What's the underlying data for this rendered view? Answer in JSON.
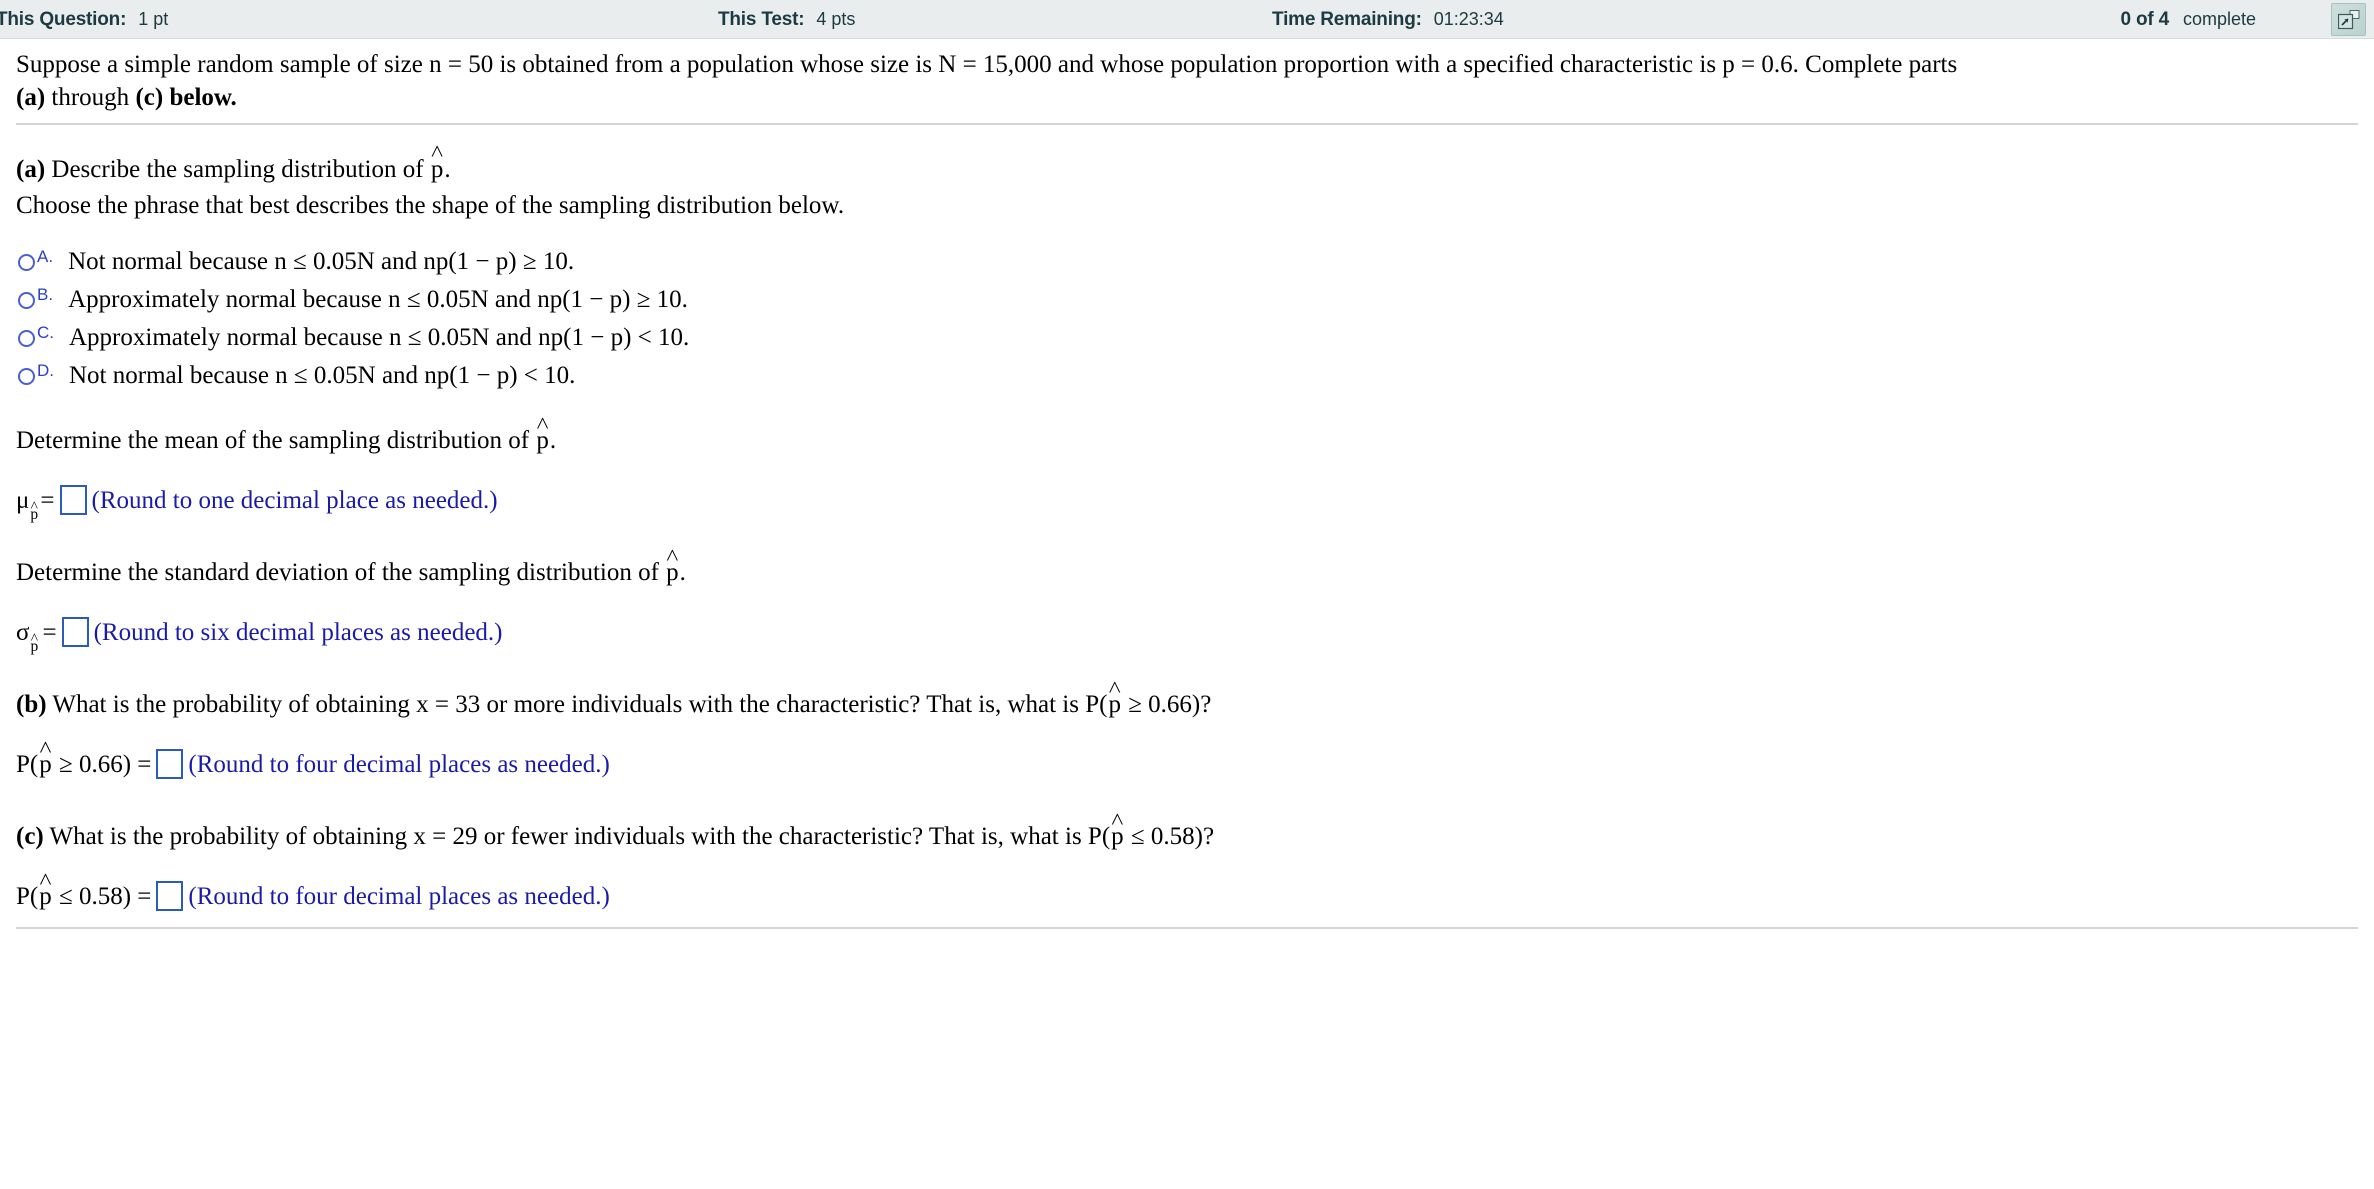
{
  "header": {
    "this_question_label": "This Question:",
    "this_question_value": "1 pt",
    "this_test_label": "This Test:",
    "this_test_value": "4 pts",
    "time_label": "Time Remaining:",
    "time_value": "01:23:34",
    "progress_count": "0 of 4",
    "progress_word": "complete",
    "expand_icon": "popout-window-icon"
  },
  "problem": {
    "intro_line1": "Suppose a simple random sample of size n = 50 is obtained from a population whose size is N = 15,000 and whose population proportion with a specified characteristic is p = 0.6. Complete parts",
    "intro_line2_bold_a": "(a)",
    "intro_line2_mid": " through ",
    "intro_line2_bold_c": "(c)",
    "intro_line2_end": " below."
  },
  "part_a": {
    "label": "(a)",
    "prompt_pre": " Describe the sampling distribution of ",
    "prompt_post": ".",
    "instruction": "Choose the phrase that best describes the shape of the sampling distribution below.",
    "choices": [
      {
        "letter": "A.",
        "text": "Not normal because n ≤ 0.05N and np(1 − p) ≥ 10.",
        "selected": false
      },
      {
        "letter": "B.",
        "text": "Approximately normal because n ≤ 0.05N and np(1 − p) ≥ 10.",
        "selected": false
      },
      {
        "letter": "C.",
        "text": "Approximately normal because n ≤ 0.05N and np(1 − p) < 10.",
        "selected": false
      },
      {
        "letter": "D.",
        "text": "Not normal because n ≤ 0.05N and np(1 − p) < 10.",
        "selected": false
      }
    ],
    "mean_prompt_pre": "Determine the mean of the sampling distribution of ",
    "mean_prompt_post": ".",
    "mean_symbol": "μ",
    "mean_equals": "=",
    "mean_value": "",
    "mean_hint": "(Round to one decimal place as needed.)",
    "sd_prompt_pre": "Determine the standard deviation of the sampling distribution of ",
    "sd_prompt_post": ".",
    "sd_symbol": "σ",
    "sd_equals": "=",
    "sd_value": "",
    "sd_hint": "(Round to six decimal places as needed.)"
  },
  "part_b": {
    "label": "(b)",
    "question_pre": " What is the probability of obtaining x = 33 or more individuals with the characteristic? That is, what is P(",
    "question_post": " ≥ 0.66)?",
    "answer_pre": "P(",
    "answer_post": " ≥ 0.66) =",
    "answer_value": "",
    "hint": "(Round to four decimal places as needed.)"
  },
  "part_c": {
    "label": "(c)",
    "question_pre": " What is the probability of obtaining x = 29 or fewer individuals with the characteristic? That is, what is P(",
    "question_post": " ≤ 0.58)?",
    "answer_pre": "P(",
    "answer_post": " ≤ 0.58) =",
    "answer_value": "",
    "hint": "(Round to four decimal places as needed.)"
  },
  "glyphs": {
    "hat": "˄",
    "p": "p"
  },
  "colors": {
    "header_bg": "#eaeded",
    "header_text": "#1b3a42",
    "hint_blue": "#1a1aa8",
    "radio_blue": "#4a5fd0",
    "answer_border": "#2a5bbd"
  }
}
